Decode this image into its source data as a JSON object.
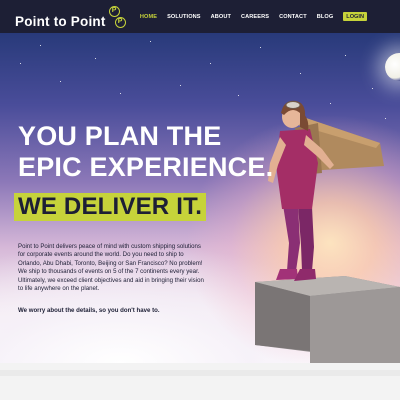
{
  "header": {
    "logo_text": "Point to Point",
    "logo_mark": [
      "P",
      "P"
    ],
    "nav": [
      {
        "label": "HOME",
        "active": true
      },
      {
        "label": "SOLUTIONS",
        "active": false
      },
      {
        "label": "ABOUT",
        "active": false
      },
      {
        "label": "CAREERS",
        "active": false
      },
      {
        "label": "CONTACT",
        "active": false
      },
      {
        "label": "BLOG",
        "active": false
      }
    ],
    "login_label": "LOGIN"
  },
  "hero": {
    "headline_line1": "YOU PLAN THE",
    "headline_line2": "EPIC EXPERIENCE.",
    "deliver": "WE DELIVER IT.",
    "body_lines": [
      "Point to Point delivers peace of mind with custom shipping solutions",
      "for corporate events around the world.  Do you need to ship to",
      "Orlando, Abu Dhabi, Toronto, Beijing or San Francisco?  No problem!",
      "We ship to thousands of events on 5 of the 7 continents every year.",
      "Ultimately, we exceed client objectives and aid in bringing their vision",
      "to life anywhere on the planet."
    ],
    "tagline": "We worry about the details, so you don't have to.",
    "illustration": "girl-with-cardboard-wings-on-box"
  },
  "colors": {
    "header_bg": "#1d1f35",
    "accent": "#c6d33a",
    "text_dark": "#1d1f35"
  }
}
